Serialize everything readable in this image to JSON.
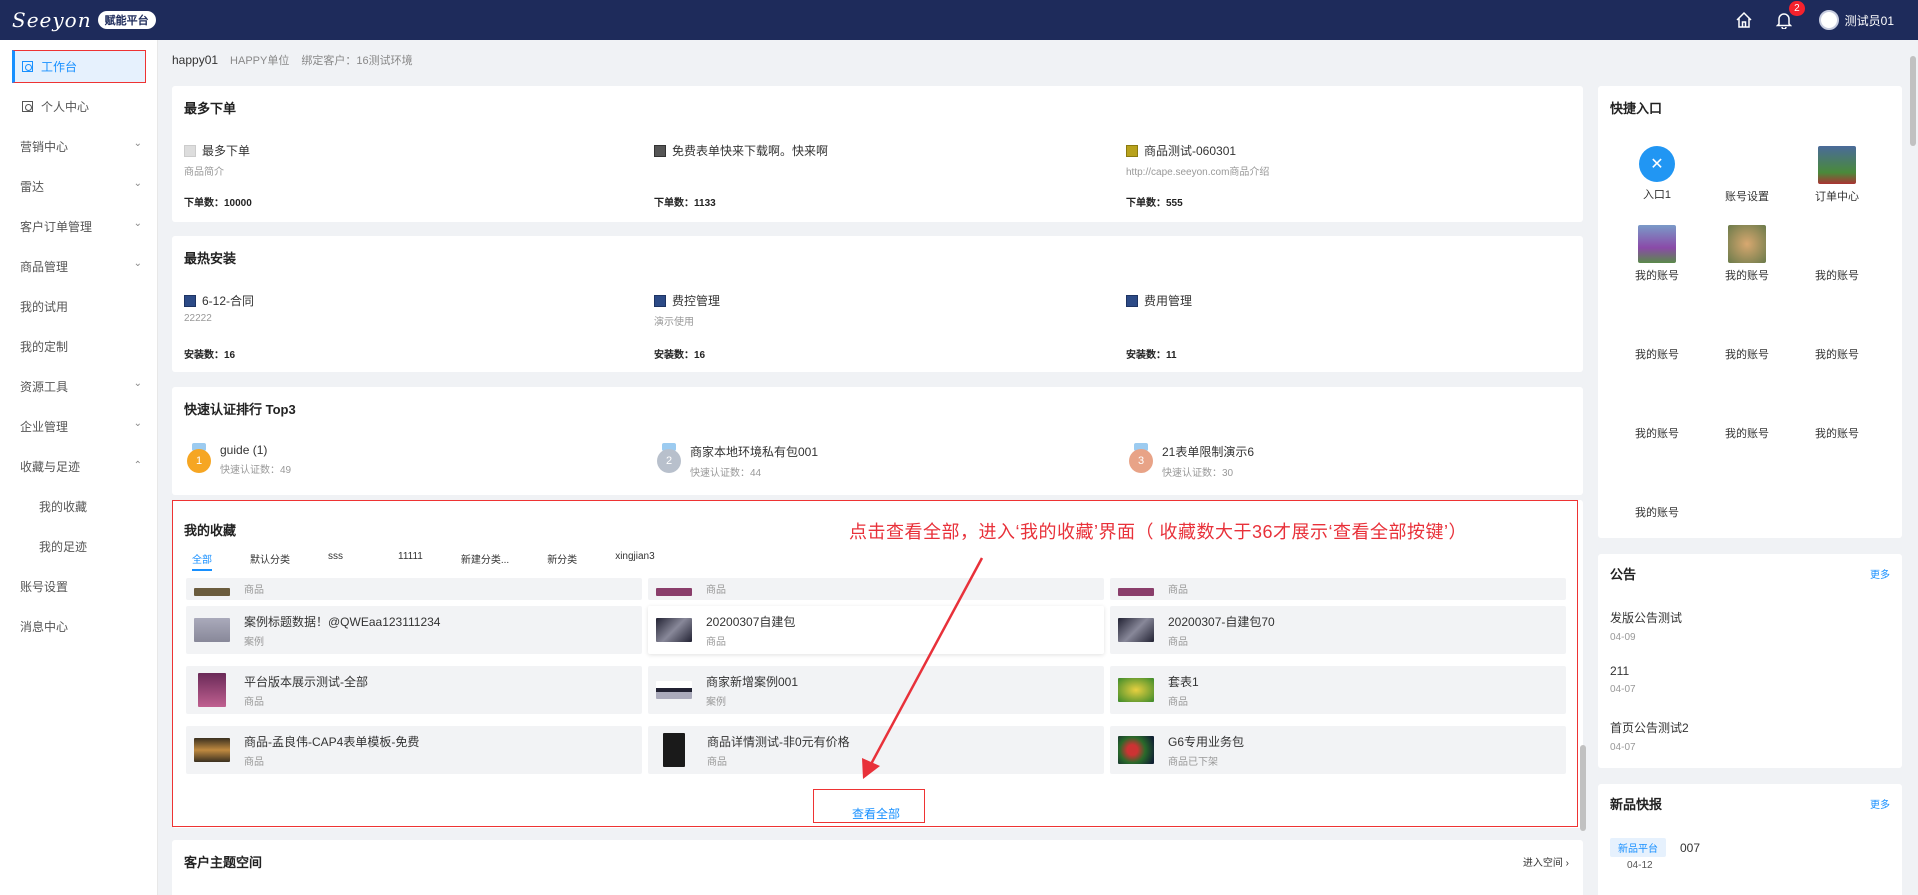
{
  "header": {
    "logo": "Seeyon",
    "badge": "赋能平台",
    "notification_count": "2",
    "user_name": "测试员01"
  },
  "sidebar": {
    "items": [
      {
        "label": "工作台",
        "active": true,
        "icon": "grid-icon"
      },
      {
        "label": "个人中心",
        "icon": "person-icon"
      },
      {
        "label": "营销中心",
        "chevron": "down"
      },
      {
        "label": "雷达",
        "chevron": "down"
      },
      {
        "label": "客户订单管理",
        "chevron": "down"
      },
      {
        "label": "商品管理",
        "chevron": "down"
      },
      {
        "label": "我的试用"
      },
      {
        "label": "我的定制"
      },
      {
        "label": "资源工具",
        "chevron": "down"
      },
      {
        "label": "企业管理",
        "chevron": "down"
      },
      {
        "label": "收藏与足迹",
        "chevron": "up"
      },
      {
        "label": "我的收藏",
        "sub": true
      },
      {
        "label": "我的足迹",
        "sub": true
      },
      {
        "label": "账号设置"
      },
      {
        "label": "消息中心"
      }
    ]
  },
  "breadcrumb": {
    "user": "happy01",
    "unit": "HAPPY单位",
    "customer": "绑定客户：16测试环境"
  },
  "most_orders": {
    "title": "最多下单",
    "items": [
      {
        "name": "最多下单",
        "desc": "商品简介",
        "count": "下单数：10000"
      },
      {
        "name": "免费表单快来下载啊。快来啊",
        "desc": "",
        "count": "下单数：1133"
      },
      {
        "name": "商品测试-060301",
        "desc": "http://cape.seeyon.com商品介绍",
        "count": "下单数：555"
      }
    ]
  },
  "hot_install": {
    "title": "最热安装",
    "items": [
      {
        "name": "6-12-合同",
        "desc": "22222",
        "count": "安装数：16"
      },
      {
        "name": "费控管理",
        "desc": "演示使用",
        "count": "安装数：16"
      },
      {
        "name": "费用管理",
        "desc": "",
        "count": "安装数：11"
      }
    ]
  },
  "cert_top3": {
    "title": "快速认证排行 Top3",
    "items": [
      {
        "rank": "1",
        "name": "guide (1)",
        "desc": "快速认证数：49",
        "color": "#f6a623"
      },
      {
        "rank": "2",
        "name": "商家本地环境私有包001",
        "desc": "快速认证数：44",
        "color": "#b8c0cc"
      },
      {
        "rank": "3",
        "name": "21表单限制演示6",
        "desc": "快速认证数：30",
        "color": "#e8a387"
      }
    ]
  },
  "favorites": {
    "title": "我的收藏",
    "annotation": "点击查看全部，进入‘我的收藏’界面（ 收藏数大于36才展示‘查看全部按键’）",
    "tabs": [
      "全部",
      "默认分类",
      "sss",
      "11111",
      "新建分类...",
      "新分类",
      "xingjian3"
    ],
    "partial_row": [
      "商品",
      "商品",
      "商品"
    ],
    "items": [
      {
        "name": "案例标题数据！@QWEaa123111234",
        "type": "案例"
      },
      {
        "name": "20200307自建包",
        "type": "商品"
      },
      {
        "name": "20200307-自建包70",
        "type": "商品"
      },
      {
        "name": "平台版本展示测试-全部",
        "type": "商品"
      },
      {
        "name": "商家新增案例001",
        "type": "案例"
      },
      {
        "name": "套表1",
        "type": "商品"
      },
      {
        "name": "商品-孟良伟-CAP4表单模板-免费",
        "type": "商品"
      },
      {
        "name": "商品详情测试-非0元有价格",
        "type": "商品"
      },
      {
        "name": "G6专用业务包",
        "type": "商品已下架"
      }
    ],
    "view_all": "查看全部"
  },
  "customer_space": {
    "title": "客户主题空间",
    "enter": "进入空间"
  },
  "quick_entry": {
    "title": "快捷入口",
    "items": [
      "入口1",
      "账号设置",
      "订单中心",
      "我的账号",
      "我的账号",
      "我的账号",
      "我的账号",
      "我的账号",
      "我的账号",
      "我的账号",
      "我的账号",
      "我的账号",
      "我的账号"
    ]
  },
  "announcements": {
    "title": "公告",
    "more": "更多",
    "items": [
      {
        "title": "发版公告测试",
        "date": "04-09"
      },
      {
        "title": "211",
        "date": "04-07"
      },
      {
        "title": "首页公告测试2",
        "date": "04-07"
      }
    ]
  },
  "new_products": {
    "title": "新品快报",
    "more": "更多",
    "items": [
      {
        "tag": "新品平台",
        "title": "007",
        "date": "04-12"
      }
    ]
  }
}
